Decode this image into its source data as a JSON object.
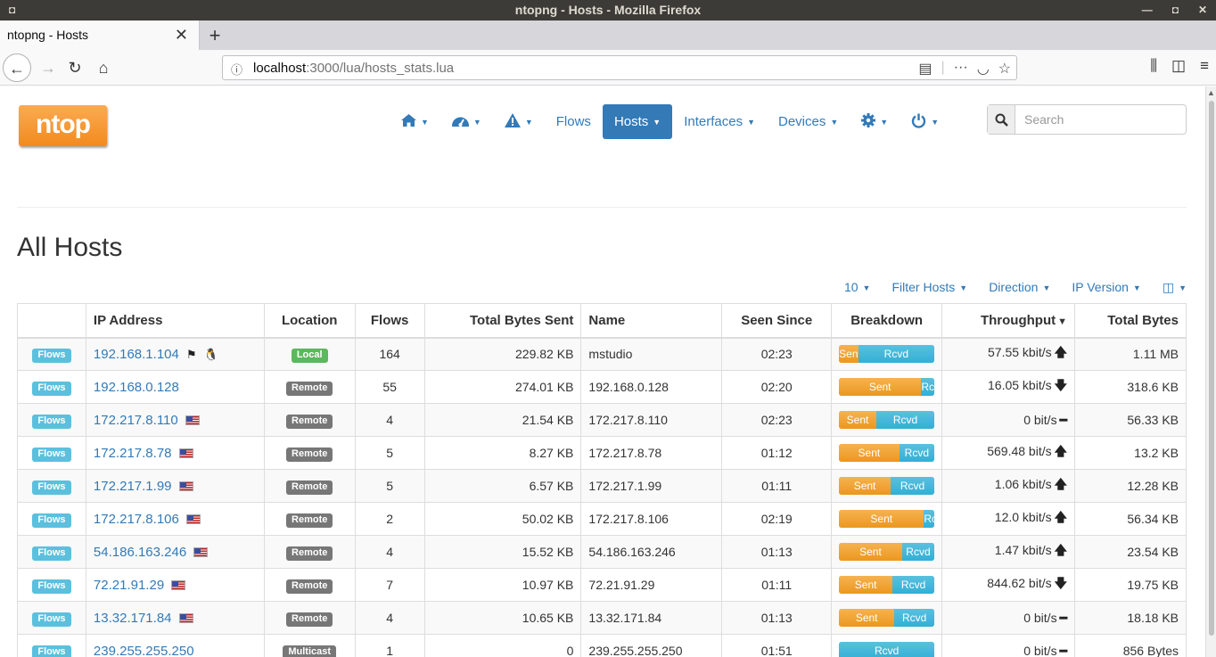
{
  "browser": {
    "window_title": "ntopng - Hosts - Mozilla Firefox",
    "tab_title": "ntopng - Hosts",
    "url_host": "localhost",
    "url_path": ":3000/lua/hosts_stats.lua"
  },
  "nav": {
    "logo": "ntop",
    "items": [
      {
        "name": "home",
        "label": "",
        "icon": "home-icon"
      },
      {
        "name": "dashboard",
        "label": "",
        "icon": "dashboard-icon"
      },
      {
        "name": "alerts",
        "label": "",
        "icon": "warning-icon"
      },
      {
        "name": "flows",
        "label": "Flows"
      },
      {
        "name": "hosts",
        "label": "Hosts",
        "active": true
      },
      {
        "name": "interfaces",
        "label": "Interfaces"
      },
      {
        "name": "devices",
        "label": "Devices"
      },
      {
        "name": "settings",
        "label": "",
        "icon": "gear-icon"
      },
      {
        "name": "power",
        "label": "",
        "icon": "power-icon"
      }
    ],
    "search_placeholder": "Search"
  },
  "page": {
    "title": "All Hosts",
    "toolbar": {
      "per_page": "10",
      "filter": "Filter Hosts",
      "direction": "Direction",
      "ip_version": "IP Version"
    }
  },
  "table": {
    "headers": [
      "",
      "IP Address",
      "Location",
      "Flows",
      "Total Bytes Sent",
      "Name",
      "Seen Since",
      "Breakdown",
      "Throughput",
      "Total Bytes"
    ],
    "flows_button": "Flows",
    "rows": [
      {
        "ip": "192.168.1.104",
        "flag": "private",
        "os": "linux",
        "location": "Local",
        "flows": "164",
        "sent": "229.82 KB",
        "name": "mstudio",
        "seen": "02:23",
        "sent_label": "Sen",
        "rcvd_label": "Rcvd",
        "sent_pct": 20,
        "throughput": "57.55 kbit/s",
        "trend": "up",
        "total": "1.11 MB"
      },
      {
        "ip": "192.168.0.128",
        "flag": "",
        "os": "",
        "location": "Remote",
        "flows": "55",
        "sent": "274.01 KB",
        "name": "192.168.0.128",
        "seen": "02:20",
        "sent_label": "Sent",
        "rcvd_label": "Rc",
        "sent_pct": 86,
        "throughput": "16.05 kbit/s",
        "trend": "down",
        "total": "318.6 KB"
      },
      {
        "ip": "172.217.8.110",
        "flag": "us",
        "os": "",
        "location": "Remote",
        "flows": "4",
        "sent": "21.54 KB",
        "name": "172.217.8.110",
        "seen": "02:23",
        "sent_label": "Sent",
        "rcvd_label": "Rcvd",
        "sent_pct": 39,
        "throughput": "0 bit/s",
        "trend": "flat",
        "total": "56.33 KB"
      },
      {
        "ip": "172.217.8.78",
        "flag": "us",
        "os": "",
        "location": "Remote",
        "flows": "5",
        "sent": "8.27 KB",
        "name": "172.217.8.78",
        "seen": "01:12",
        "sent_label": "Sent",
        "rcvd_label": "Rcvd",
        "sent_pct": 63,
        "throughput": "569.48 bit/s",
        "trend": "up",
        "total": "13.2 KB"
      },
      {
        "ip": "172.217.1.99",
        "flag": "us",
        "os": "",
        "location": "Remote",
        "flows": "5",
        "sent": "6.57 KB",
        "name": "172.217.1.99",
        "seen": "01:11",
        "sent_label": "Sent",
        "rcvd_label": "Rcvd",
        "sent_pct": 54,
        "throughput": "1.06 kbit/s",
        "trend": "up",
        "total": "12.28 KB"
      },
      {
        "ip": "172.217.8.106",
        "flag": "us",
        "os": "",
        "location": "Remote",
        "flows": "2",
        "sent": "50.02 KB",
        "name": "172.217.8.106",
        "seen": "02:19",
        "sent_label": "Sent",
        "rcvd_label": "Rc",
        "sent_pct": 89,
        "throughput": "12.0 kbit/s",
        "trend": "up",
        "total": "56.34 KB"
      },
      {
        "ip": "54.186.163.246",
        "flag": "us",
        "os": "",
        "location": "Remote",
        "flows": "4",
        "sent": "15.52 KB",
        "name": "54.186.163.246",
        "seen": "01:13",
        "sent_label": "Sent",
        "rcvd_label": "Rcvd",
        "sent_pct": 66,
        "throughput": "1.47 kbit/s",
        "trend": "up",
        "total": "23.54 KB"
      },
      {
        "ip": "72.21.91.29",
        "flag": "us",
        "os": "",
        "location": "Remote",
        "flows": "7",
        "sent": "10.97 KB",
        "name": "72.21.91.29",
        "seen": "01:11",
        "sent_label": "Sent",
        "rcvd_label": "Rcvd",
        "sent_pct": 56,
        "throughput": "844.62 bit/s",
        "trend": "down",
        "total": "19.75 KB"
      },
      {
        "ip": "13.32.171.84",
        "flag": "us",
        "os": "",
        "location": "Remote",
        "flows": "4",
        "sent": "10.65 KB",
        "name": "13.32.171.84",
        "seen": "01:13",
        "sent_label": "Sent",
        "rcvd_label": "Rcvd",
        "sent_pct": 58,
        "throughput": "0 bit/s",
        "trend": "flat",
        "total": "18.18 KB"
      },
      {
        "ip": "239.255.255.250",
        "flag": "",
        "os": "",
        "location": "Multicast",
        "flows": "1",
        "sent": "0",
        "name": "239.255.255.250",
        "seen": "01:51",
        "sent_label": "",
        "rcvd_label": "Rcvd",
        "sent_pct": 0,
        "throughput": "0 bit/s",
        "trend": "flat",
        "total": "856 Bytes"
      }
    ]
  },
  "colors": {
    "link": "#337ab7",
    "sent": "#f0ad4e",
    "rcvd": "#5bc0de",
    "local": "#5cb85c",
    "remote": "#777777"
  }
}
